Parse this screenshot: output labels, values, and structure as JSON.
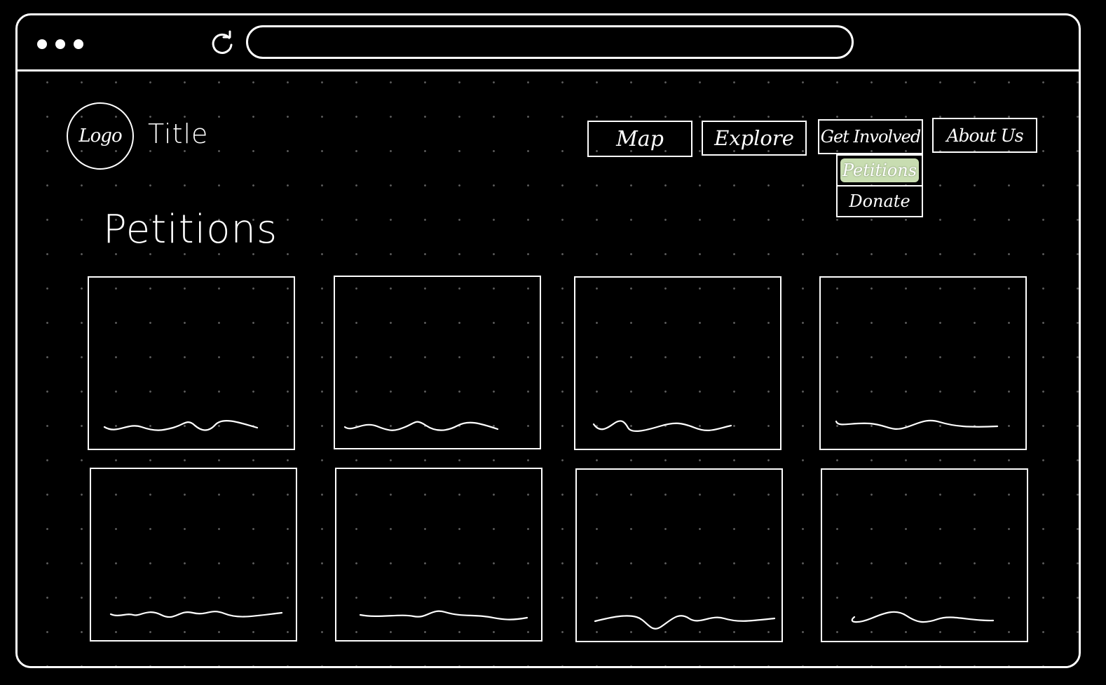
{
  "browser": {
    "url": ""
  },
  "header": {
    "logo_text": "Logo",
    "title": "Title"
  },
  "nav": {
    "items": [
      "Map",
      "Explore",
      "Get Involved",
      "About Us"
    ],
    "dropdown": {
      "parent": "Get Involved",
      "items": [
        "Petitions",
        "Donate"
      ],
      "active": "Petitions"
    }
  },
  "main": {
    "heading": "Petitions"
  },
  "colors": {
    "background": "#000000",
    "stroke": "#ffffff",
    "highlight": "#c8ddb1"
  }
}
